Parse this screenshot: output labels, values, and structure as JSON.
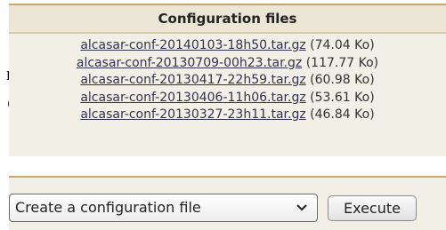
{
  "side_text": [
    "n",
    "e"
  ],
  "config_panel": {
    "title": "Configuration files",
    "files": [
      {
        "name": "alcasar-conf-20140103-18h50.tar.gz",
        "size": "(74.04 Ko)"
      },
      {
        "name": "alcasar-conf-20130709-00h23.tar.gz",
        "size": "(117.77 Ko)"
      },
      {
        "name": "alcasar-conf-20130417-22h59.tar.gz",
        "size": "(60.98 Ko)"
      },
      {
        "name": "alcasar-conf-20130406-11h06.tar.gz",
        "size": "(53.61 Ko)"
      },
      {
        "name": "alcasar-conf-20130327-23h11.tar.gz",
        "size": "(46.84 Ko)"
      }
    ]
  },
  "action_bar": {
    "select_value": "Create a configuration file",
    "select_icon": "chevron-down-icon",
    "execute_label": "Execute"
  },
  "colors": {
    "panel_bg": "#f2efe6",
    "panel_border": "#c9a86b",
    "link": "#33334d"
  }
}
